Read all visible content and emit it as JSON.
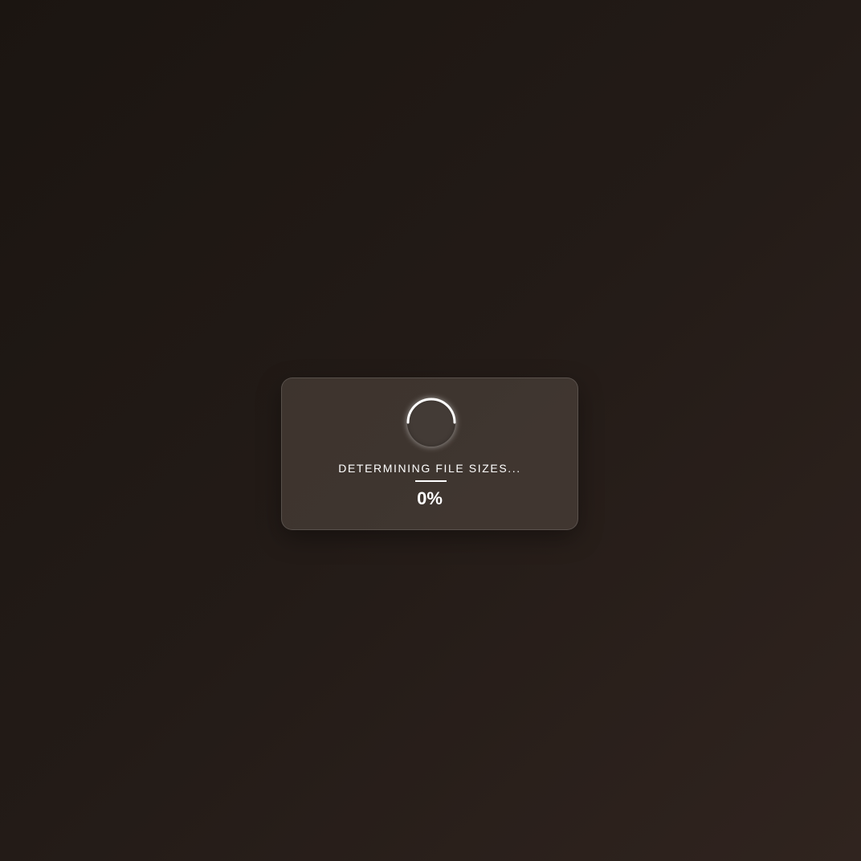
{
  "loader": {
    "status_text": "DETERMINING FILE SIZES...",
    "percent_label": "0%",
    "progress": 0,
    "spinner_icon": "loading-spinner-icon"
  },
  "colors": {
    "background_dark": "#1b1511",
    "background_light": "#30241f",
    "text": "#ffffff",
    "spinner_arc": "#ffffff"
  }
}
